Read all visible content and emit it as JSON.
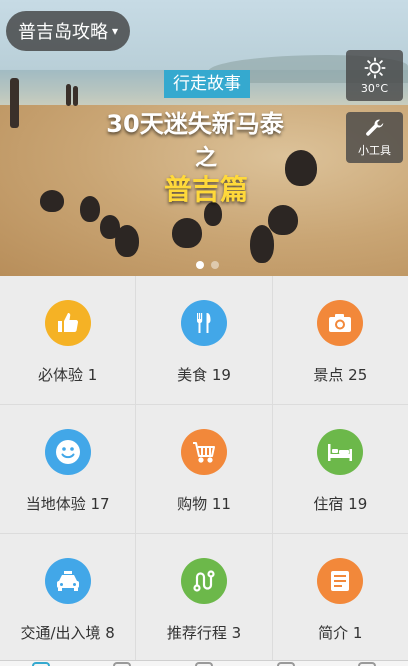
{
  "header": {
    "city_label": "普吉岛攻略",
    "city_caret": "▾"
  },
  "hero": {
    "tag": "行走故事",
    "title_line1": "30天迷失新马泰",
    "title_line2": "之",
    "title_line3": "普吉篇",
    "slide_count": 2,
    "active_slide": 1
  },
  "side_tools": {
    "weather_temp": "30°C",
    "tools_label": "小工具"
  },
  "grid": {
    "items": [
      {
        "label": "必体验 1",
        "icon": "thumbs-up-icon",
        "color": "#f5b225"
      },
      {
        "label": "美食 19",
        "icon": "fork-knife-icon",
        "color": "#42a7e8"
      },
      {
        "label": "景点 25",
        "icon": "camera-icon",
        "color": "#f2883a"
      },
      {
        "label": "当地体验 17",
        "icon": "smiley-icon",
        "color": "#42a7e8"
      },
      {
        "label": "购物 11",
        "icon": "cart-icon",
        "color": "#f2883a"
      },
      {
        "label": "住宿 19",
        "icon": "bed-icon",
        "color": "#6cb84a"
      },
      {
        "label": "交通/出入境 8",
        "icon": "taxi-icon",
        "color": "#42a7e8"
      },
      {
        "label": "推荐行程 3",
        "icon": "route-icon",
        "color": "#6cb84a"
      },
      {
        "label": "简介 1",
        "icon": "document-icon",
        "color": "#f2883a"
      }
    ]
  },
  "colors": {
    "accent": "#35a9cf",
    "highlight_title": "#ffd93a"
  }
}
